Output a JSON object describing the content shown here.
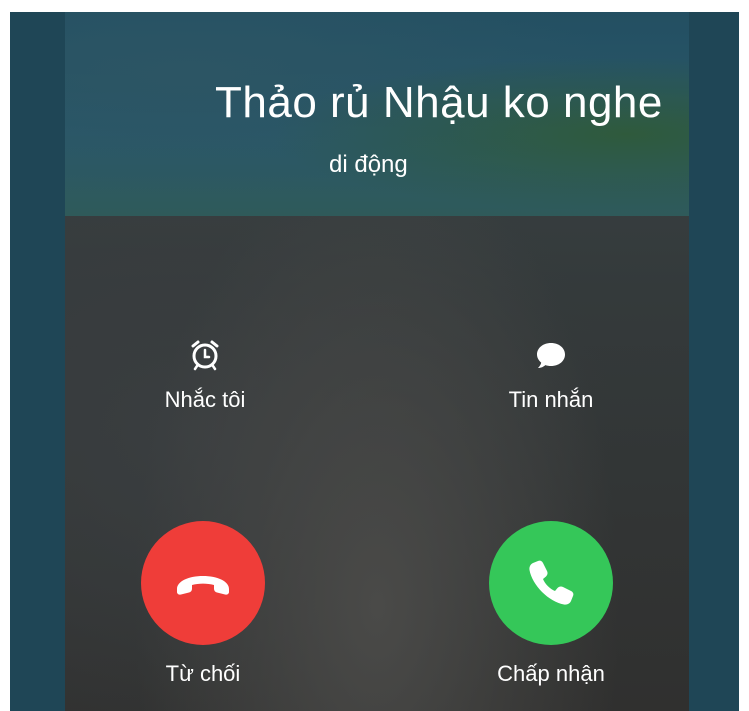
{
  "caller": {
    "name": "Thảo rủ Nhậu ko nghe",
    "label": "di động"
  },
  "options": {
    "remind_label": "Nhắc tôi",
    "message_label": "Tin nhắn"
  },
  "actions": {
    "decline_label": "Từ chối",
    "accept_label": "Chấp nhận"
  },
  "colors": {
    "frame_bg": "#1f4656",
    "decline": "#ef3d39",
    "accept": "#35c759"
  },
  "icons": {
    "remind": "alarm-clock-icon",
    "message": "speech-bubble-icon",
    "decline": "phone-hangup-icon",
    "accept": "phone-icon"
  }
}
